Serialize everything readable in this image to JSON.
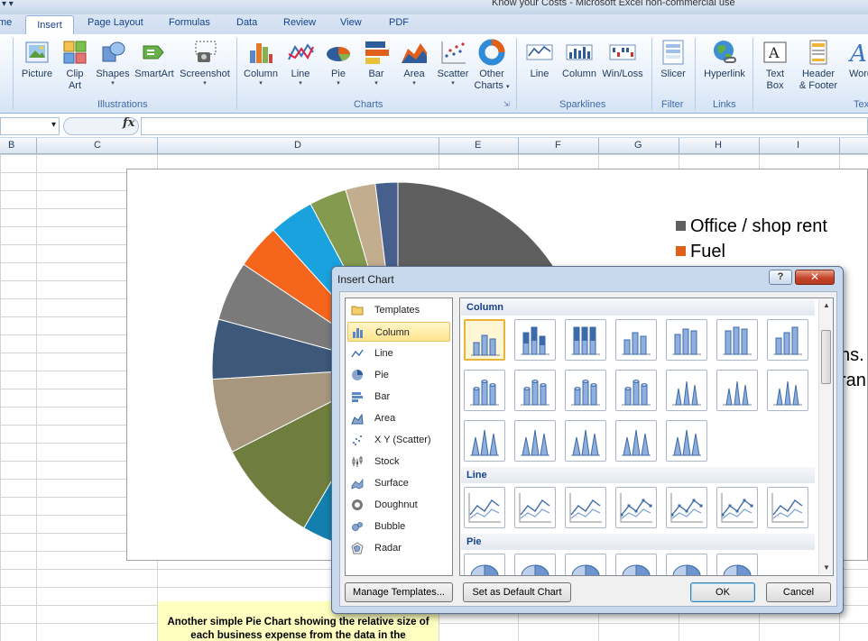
{
  "window": {
    "title": "Know your Costs - Microsoft Excel non-commercial use"
  },
  "tabs": [
    {
      "label": "me"
    },
    {
      "label": "Insert"
    },
    {
      "label": "Page Layout"
    },
    {
      "label": "Formulas"
    },
    {
      "label": "Data"
    },
    {
      "label": "Review"
    },
    {
      "label": "View"
    },
    {
      "label": "PDF"
    }
  ],
  "ribbon": {
    "illustrations": {
      "label": "Illustrations",
      "picture": "Picture",
      "clip_art_1": "Clip",
      "clip_art_2": "Art",
      "shapes": "Shapes",
      "smartart": "SmartArt",
      "screenshot": "Screenshot"
    },
    "charts": {
      "label": "Charts",
      "column": "Column",
      "line": "Line",
      "pie": "Pie",
      "bar": "Bar",
      "area": "Area",
      "scatter": "Scatter",
      "other_1": "Other",
      "other_2": "Charts"
    },
    "sparklines": {
      "label": "Sparklines",
      "line": "Line",
      "column": "Column",
      "winloss": "Win/Loss"
    },
    "filter": {
      "label": "Filter",
      "slicer": "Slicer"
    },
    "links": {
      "label": "Links",
      "hyperlink": "Hyperlink"
    },
    "text": {
      "label": "Tex",
      "textbox_1": "Text",
      "textbox_2": "Box",
      "header_1": "Header",
      "header_2": "& Footer",
      "wordart": "Word"
    },
    "dropdown_glyph": "▾"
  },
  "formula_bar": {
    "fx": "fx",
    "dropdown": "▾"
  },
  "columns": [
    "B",
    "C",
    "D",
    "E",
    "F",
    "G",
    "H",
    "I"
  ],
  "chart": {
    "legend": [
      {
        "label": "Office / shop rent",
        "color": "#5f5f5f"
      },
      {
        "label": "Fuel",
        "color": "#e0601a"
      }
    ],
    "peek_1": "ns.",
    "peek_2": "ran"
  },
  "chart_data": {
    "type": "pie",
    "categories": [],
    "series": [
      {
        "values": [
          20,
          13,
          12,
          7,
          5,
          4,
          4,
          3,
          3,
          2.5,
          2,
          1.5
        ]
      }
    ],
    "colors": [
      "#5f5f5f",
      "#d8d8d8",
      "#127fac",
      "#6f7d3e",
      "#a8977f",
      "#3e5879",
      "#7a7a7a",
      "#f5651b",
      "#1aa2df",
      "#849a4f",
      "#c3ad8f",
      "#465f8d"
    ],
    "legend_position": "right"
  },
  "note": {
    "line1": "Another simple Pie Chart showing the relative size of",
    "line2": "each business expense from the data in the"
  },
  "dialog": {
    "title": "Insert Chart",
    "help": "?",
    "close": "✕",
    "categories": [
      {
        "label": "Templates"
      },
      {
        "label": "Column"
      },
      {
        "label": "Line"
      },
      {
        "label": "Pie"
      },
      {
        "label": "Bar"
      },
      {
        "label": "Area"
      },
      {
        "label": "X Y (Scatter)"
      },
      {
        "label": "Stock"
      },
      {
        "label": "Surface"
      },
      {
        "label": "Doughnut"
      },
      {
        "label": "Bubble"
      },
      {
        "label": "Radar"
      }
    ],
    "selected_category": "Column",
    "sections": {
      "column": "Column",
      "line": "Line",
      "pie": "Pie"
    },
    "buttons": {
      "manage_templates": "Manage Templates...",
      "set_default": "Set as Default Chart",
      "ok": "OK",
      "cancel": "Cancel"
    }
  }
}
